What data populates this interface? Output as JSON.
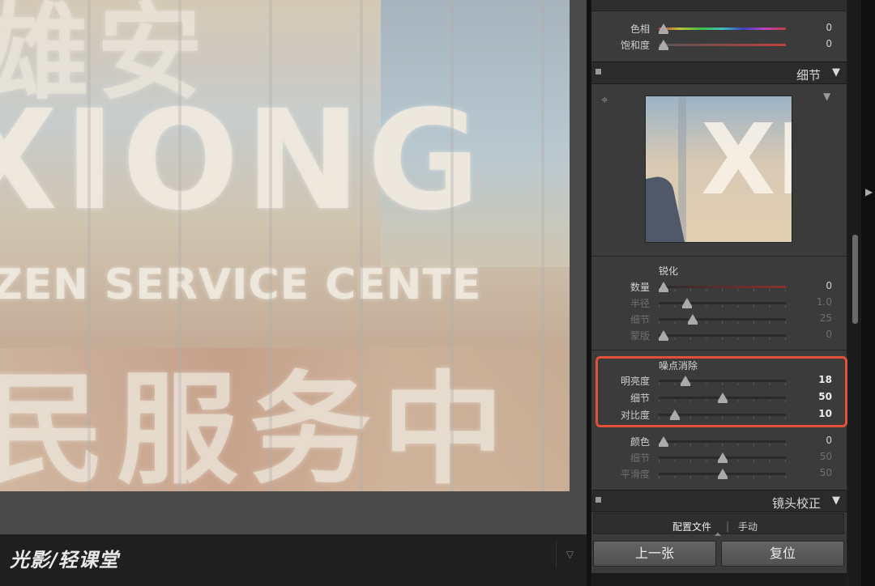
{
  "watermark": {
    "logo": "光影/轻课堂"
  },
  "hsl_rows": [
    {
      "label": "色相",
      "value": "0",
      "pos": 0.04
    },
    {
      "label": "饱和度",
      "value": "0",
      "pos": 0.04
    }
  ],
  "detail_panel": {
    "title": "细节",
    "collapse_icon": "triangle-down-icon",
    "sharpening": {
      "heading": "锐化",
      "rows": [
        {
          "label": "数量",
          "value": "0",
          "pos": 0.04
        },
        {
          "label": "半径",
          "value": "1.0",
          "pos": 0.22
        },
        {
          "label": "细节",
          "value": "25",
          "pos": 0.27
        },
        {
          "label": "蒙版",
          "value": "0",
          "pos": 0.04
        }
      ]
    },
    "noise_reduction": {
      "heading": "噪点消除",
      "rows": [
        {
          "label": "明亮度",
          "value": "18",
          "pos": 0.21
        },
        {
          "label": "细节",
          "value": "50",
          "pos": 0.5
        },
        {
          "label": "对比度",
          "value": "10",
          "pos": 0.13
        }
      ],
      "color_rows": [
        {
          "label": "颜色",
          "value": "0",
          "pos": 0.04
        },
        {
          "label": "细节",
          "value": "50",
          "pos": 0.5
        },
        {
          "label": "平滑度",
          "value": "50",
          "pos": 0.5
        }
      ]
    }
  },
  "lens_panel": {
    "title": "镜头校正",
    "tabs": [
      "配置文件",
      "手动"
    ],
    "tab_separator": "|"
  },
  "buttons": {
    "previous": "上一张",
    "reset": "复位"
  },
  "colors": {
    "highlight": "#e2503a",
    "panel_bg": "#3b3b3b"
  }
}
